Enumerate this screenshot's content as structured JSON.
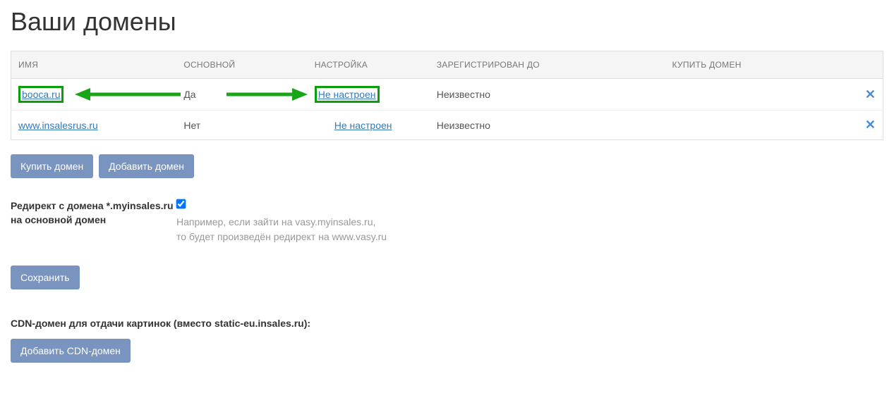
{
  "page_title": "Ваши домены",
  "table": {
    "headers": {
      "name": "ИМЯ",
      "main": "ОСНОВНОЙ",
      "setup": "НАСТРОЙКА",
      "registered": "ЗАРЕГИСТРИРОВАН ДО",
      "buy": "КУПИТЬ ДОМЕН"
    },
    "rows": [
      {
        "name": "booca.ru",
        "main": "Да",
        "setup": "Не настроен",
        "registered": "Неизвестно",
        "buy": ""
      },
      {
        "name": "www.insalesrus.ru",
        "main": "Нет",
        "setup": "Не настроен",
        "registered": "Неизвестно",
        "buy": ""
      }
    ]
  },
  "buttons": {
    "buy_domain": "Купить домен",
    "add_domain": "Добавить домен",
    "save": "Сохранить",
    "add_cdn": "Добавить CDN-домен"
  },
  "redirect": {
    "label": "Редирект с домена *.myinsales.ru на основной домен",
    "help1": "Например, если зайти на vasy.myinsales.ru,",
    "help2": "то будет произведён редирект на www.vasy.ru",
    "checked": true
  },
  "cdn": {
    "heading": "CDN-домен для отдачи картинок (вместо static-eu.insales.ru):"
  }
}
